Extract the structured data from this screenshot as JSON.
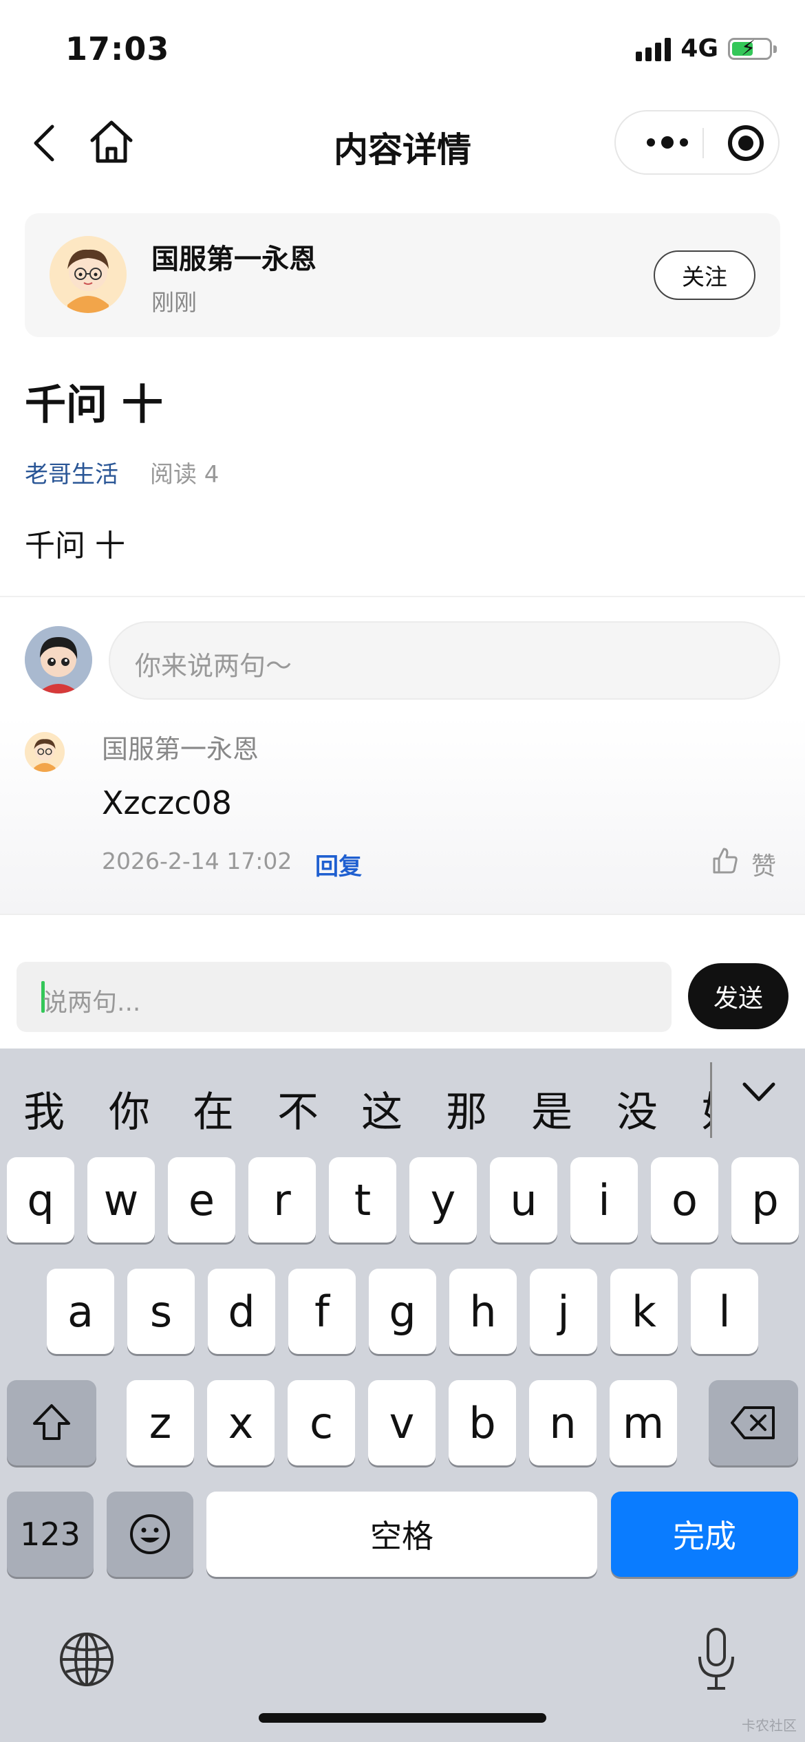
{
  "status_bar": {
    "time": "17:03",
    "network": "4G"
  },
  "nav": {
    "title": "内容详情"
  },
  "author": {
    "name": "国服第一永恩",
    "time": "刚刚",
    "follow_label": "关注"
  },
  "post": {
    "title": "千问 十",
    "category": "老哥生活",
    "read_count": "阅读 4",
    "body": "千问 十"
  },
  "comment_input": {
    "placeholder": "你来说两句～"
  },
  "comments": [
    {
      "name": "国服第一永恩",
      "text": "Xzczc08",
      "time": "2026-2-14 17:02",
      "reply_label": "回复",
      "like_label": "赞"
    }
  ],
  "reply_bar": {
    "placeholder": "说两句...",
    "send_label": "发送"
  },
  "keyboard": {
    "candidates": [
      "我",
      "你",
      "在",
      "不",
      "这",
      "那",
      "是",
      "没",
      "好"
    ],
    "row1": [
      "q",
      "w",
      "e",
      "r",
      "t",
      "y",
      "u",
      "i",
      "o",
      "p"
    ],
    "row2": [
      "a",
      "s",
      "d",
      "f",
      "g",
      "h",
      "j",
      "k",
      "l"
    ],
    "row3": [
      "z",
      "x",
      "c",
      "v",
      "b",
      "n",
      "m"
    ],
    "numbers_label": "123",
    "space_label": "空格",
    "done_label": "完成",
    "accent_color": "#0a7cff"
  },
  "watermark": "卡农社区"
}
